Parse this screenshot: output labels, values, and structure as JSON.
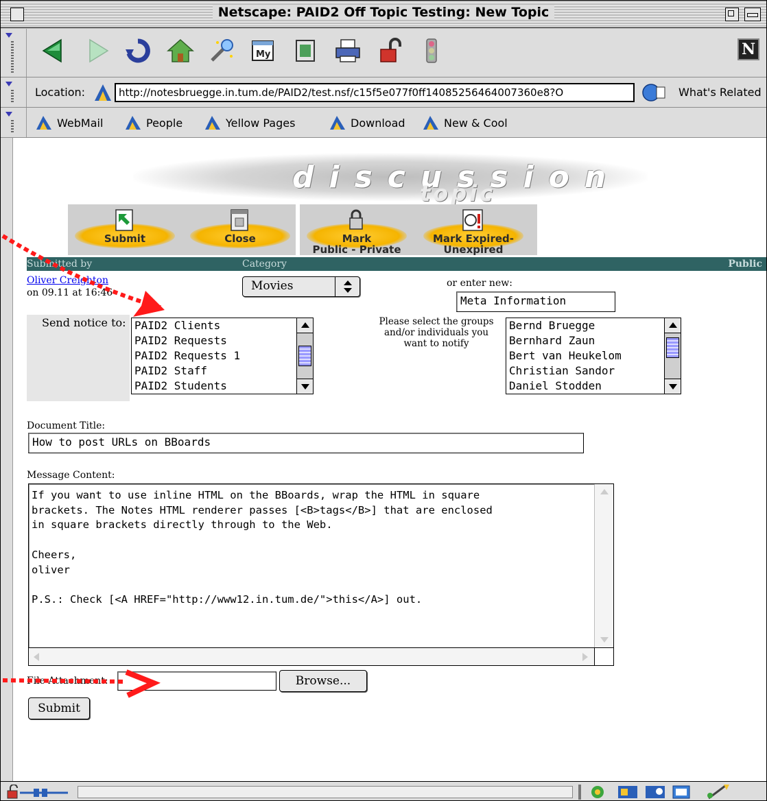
{
  "window": {
    "title": "Netscape: PAID2 Off Topic Testing: New Topic"
  },
  "location": {
    "label": "Location:",
    "url": "http://notesbruegge.in.tum.de/PAID2/test.nsf/c15f5e077f0ff14085256464007360e8?O",
    "related_label": "What's Related"
  },
  "personal_toolbar": {
    "items": [
      "WebMail",
      "People",
      "Yellow Pages",
      "Download",
      "New & Cool"
    ]
  },
  "banner": {
    "main": "discussion",
    "sub": "topic"
  },
  "actions": {
    "submit": "Submit",
    "close": "Close",
    "mark_public_1": "Mark",
    "mark_public_2": "Public - Private",
    "mark_expired_1": "Mark Expired-",
    "mark_expired_2": "Unexpired"
  },
  "header_bar": {
    "submitted_by": "Submitted by",
    "category": "Category",
    "status": "Public"
  },
  "author": {
    "name": "Oliver Creighton",
    "date": "on 09.11 at 16:46"
  },
  "category": {
    "selected": "Movies",
    "or_enter_new_label": "or enter new:",
    "new_value": "Meta Information"
  },
  "notify": {
    "label": "Send notice to:",
    "groups": [
      "PAID2 Clients",
      "PAID2 Requests",
      "PAID2 Requests 1",
      "PAID2 Staff",
      "PAID2 Students"
    ],
    "help_text_1": "Please select the groups",
    "help_text_2": "and/or individuals you",
    "help_text_3": "want to notify",
    "people": [
      "Bernd Bruegge",
      "Bernhard Zaun",
      "Bert van Heukelom",
      "Christian Sandor",
      "Daniel Stodden"
    ]
  },
  "document_title": {
    "label": "Document Title:",
    "value": "How to post URLs on BBoards"
  },
  "message": {
    "label": "Message Content:",
    "lines": [
      "If you want to use inline HTML on the BBoards, wrap the HTML in square",
      "brackets. The Notes HTML renderer passes [<B>tags</B>] that are enclosed",
      "in square brackets directly through to the Web.",
      "",
      "Cheers,",
      "oliver",
      "",
      "P.S.: Check [<A HREF=\"http://www12.in.tum.de/\">this</A>] out."
    ]
  },
  "attachment": {
    "label": "File Attachment:",
    "browse_label": "Browse..."
  },
  "form": {
    "submit_label": "Submit"
  },
  "colors": {
    "header_teal": "#2f6363",
    "annotation_red": "#ff1a1a",
    "accent_yellow": "#f5b400"
  }
}
